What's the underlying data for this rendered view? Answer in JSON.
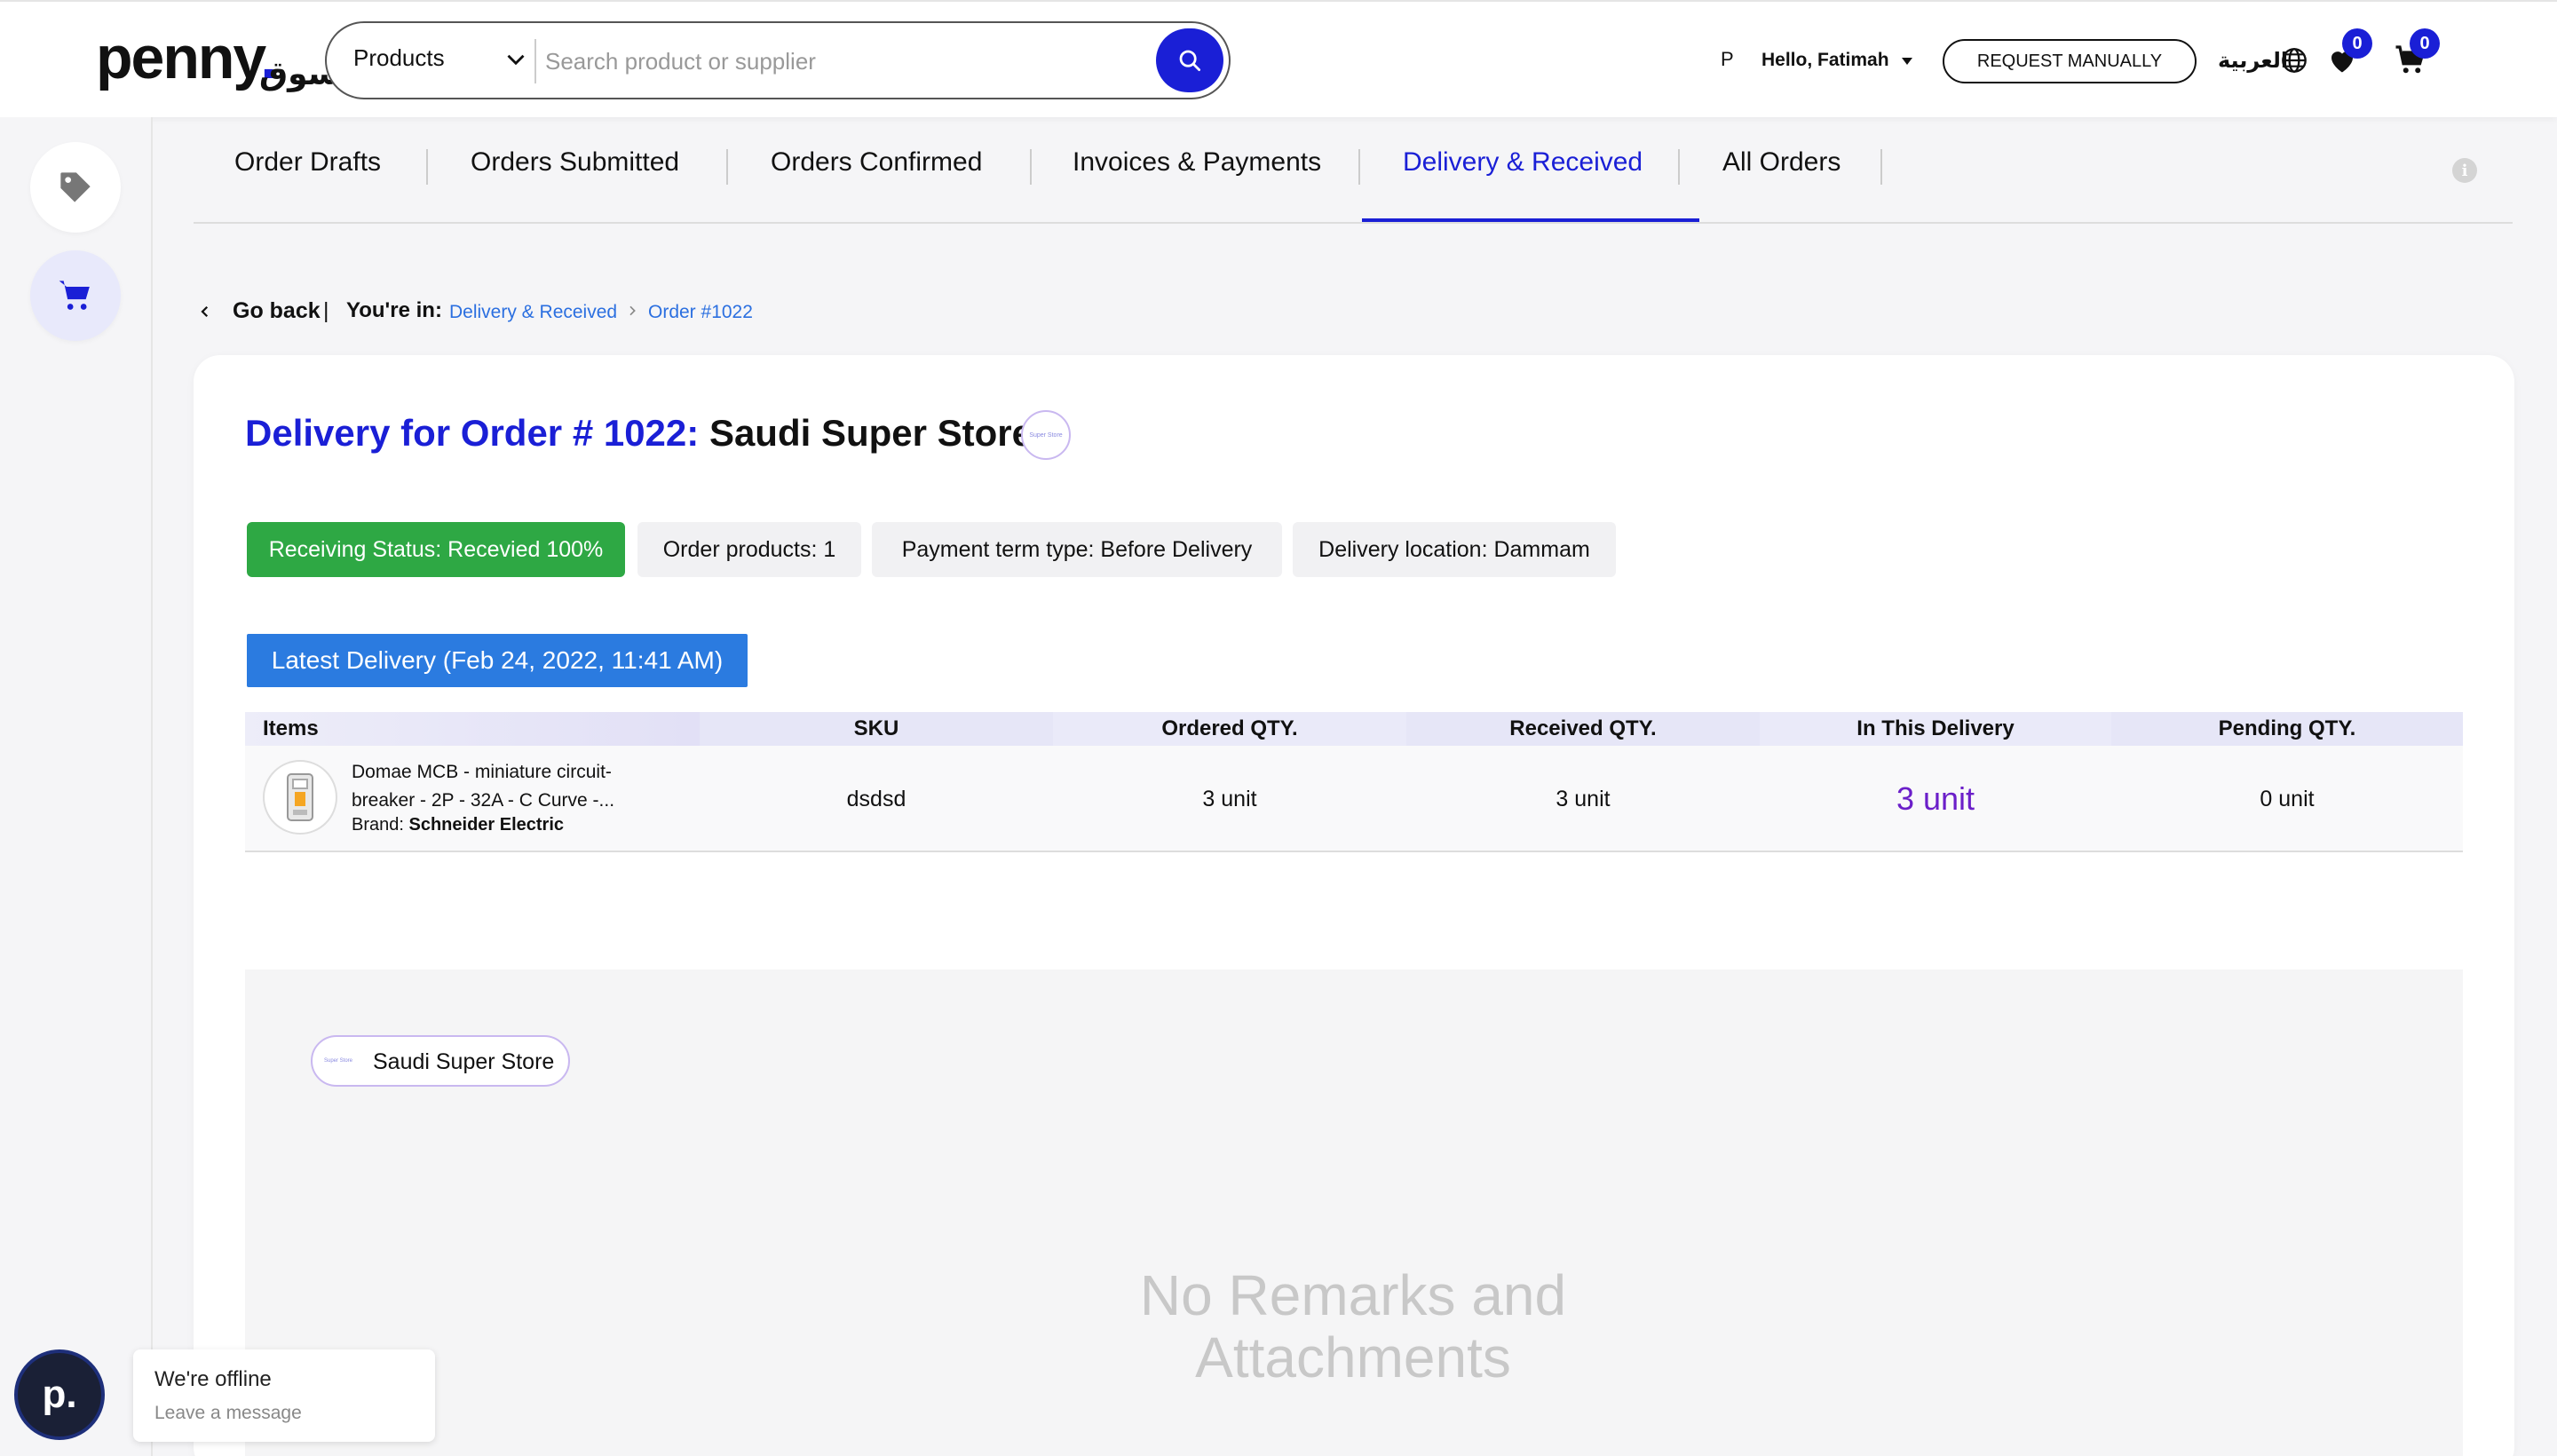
{
  "header": {
    "logo": "penny",
    "logo_ar": "سوق",
    "search": {
      "category": "Products",
      "placeholder": "Search product or supplier"
    },
    "user_initial": "P",
    "greeting": "Hello, Fatimah",
    "request_button": "REQUEST MANUALLY",
    "language": "العربية",
    "wishlist_count": "0",
    "cart_count": "0"
  },
  "tabs": [
    {
      "label": "Order Drafts"
    },
    {
      "label": "Orders Submitted"
    },
    {
      "label": "Orders Confirmed"
    },
    {
      "label": "Invoices & Payments"
    },
    {
      "label": "Delivery & Received"
    },
    {
      "label": "All Orders"
    }
  ],
  "breadcrumb": {
    "back": "Go back",
    "separator": "|",
    "you_are_in": "You're in:",
    "items": [
      "Delivery & Received",
      "Order #1022"
    ]
  },
  "order": {
    "title_prefix": "Delivery for Order # 1022:",
    "store_name": "Saudi Super Store",
    "store_logo_text": "Super Store",
    "pills": {
      "status": "Receiving Status: Recevied 100%",
      "products": "Order products: 1",
      "payment": "Payment term type: Before Delivery",
      "location": "Delivery location: Dammam"
    },
    "latest_delivery": "Latest Delivery (Feb 24, 2022, 11:41 AM)"
  },
  "table": {
    "columns": [
      "Items",
      "SKU",
      "Ordered QTY.",
      "Received QTY.",
      "In This Delivery",
      "Pending QTY."
    ],
    "rows": [
      {
        "name": "Domae MCB - miniature circuit-breaker - 2P - 32A - C Curve -...",
        "brand_label": "Brand:",
        "brand": "Schneider Electric",
        "sku": "dsdsd",
        "ordered": "3 unit",
        "received": "3 unit",
        "in_delivery": "3 unit",
        "pending": "0 unit"
      }
    ]
  },
  "remarks": {
    "store_name": "Saudi Super Store",
    "store_logo_text": "Super Store",
    "empty_text": "No Remarks and Attachments"
  },
  "chat": {
    "avatar_letter": "p.",
    "title": "We're offline",
    "subtitle": "Leave a message"
  },
  "colors": {
    "brand": "#1a1fd6",
    "link": "#2b6fe0",
    "success": "#2ea844",
    "accent_purple": "#6b1fc9"
  }
}
